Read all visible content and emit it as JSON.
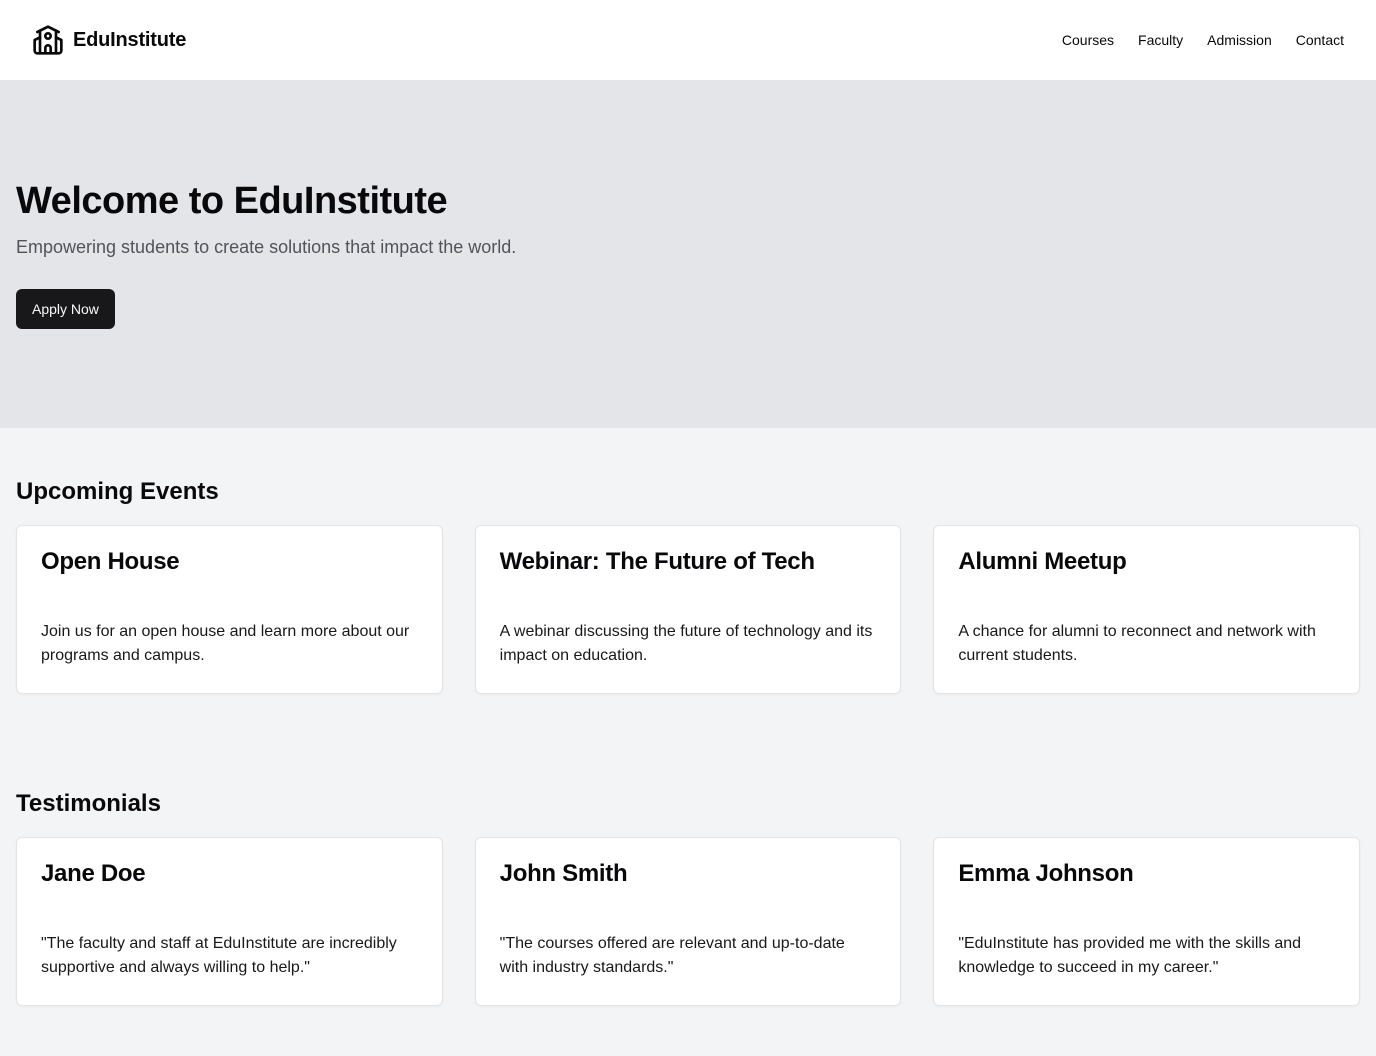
{
  "header": {
    "brand_name": "EduInstitute",
    "brand_icon": "school-icon",
    "nav": [
      {
        "label": "Courses"
      },
      {
        "label": "Faculty"
      },
      {
        "label": "Admission"
      },
      {
        "label": "Contact"
      }
    ]
  },
  "hero": {
    "title": "Welcome to EduInstitute",
    "subtitle": "Empowering students to create solutions that impact the world.",
    "cta_label": "Apply Now"
  },
  "events": {
    "title": "Upcoming Events",
    "items": [
      {
        "title": "Open House",
        "description": "Join us for an open house and learn more about our programs and campus."
      },
      {
        "title": "Webinar: The Future of Tech",
        "description": "A webinar discussing the future of technology and its impact on education."
      },
      {
        "title": "Alumni Meetup",
        "description": "A chance for alumni to reconnect and network with current students."
      }
    ]
  },
  "testimonials": {
    "title": "Testimonials",
    "items": [
      {
        "name": "Jane Doe",
        "quote": "\"The faculty and staff at EduInstitute are incredibly supportive and always willing to help.\""
      },
      {
        "name": "John Smith",
        "quote": "\"The courses offered are relevant and up-to-date with industry standards.\""
      },
      {
        "name": "Emma Johnson",
        "quote": "\"EduInstitute has provided me with the skills and knowledge to succeed in my career.\""
      }
    ]
  },
  "colors": {
    "header_bg": "#ffffff",
    "hero_bg": "#e4e5e9",
    "page_bg": "#f3f4f6",
    "button_bg": "#18181b",
    "button_text": "#fafafa",
    "muted_text": "#52525b"
  }
}
